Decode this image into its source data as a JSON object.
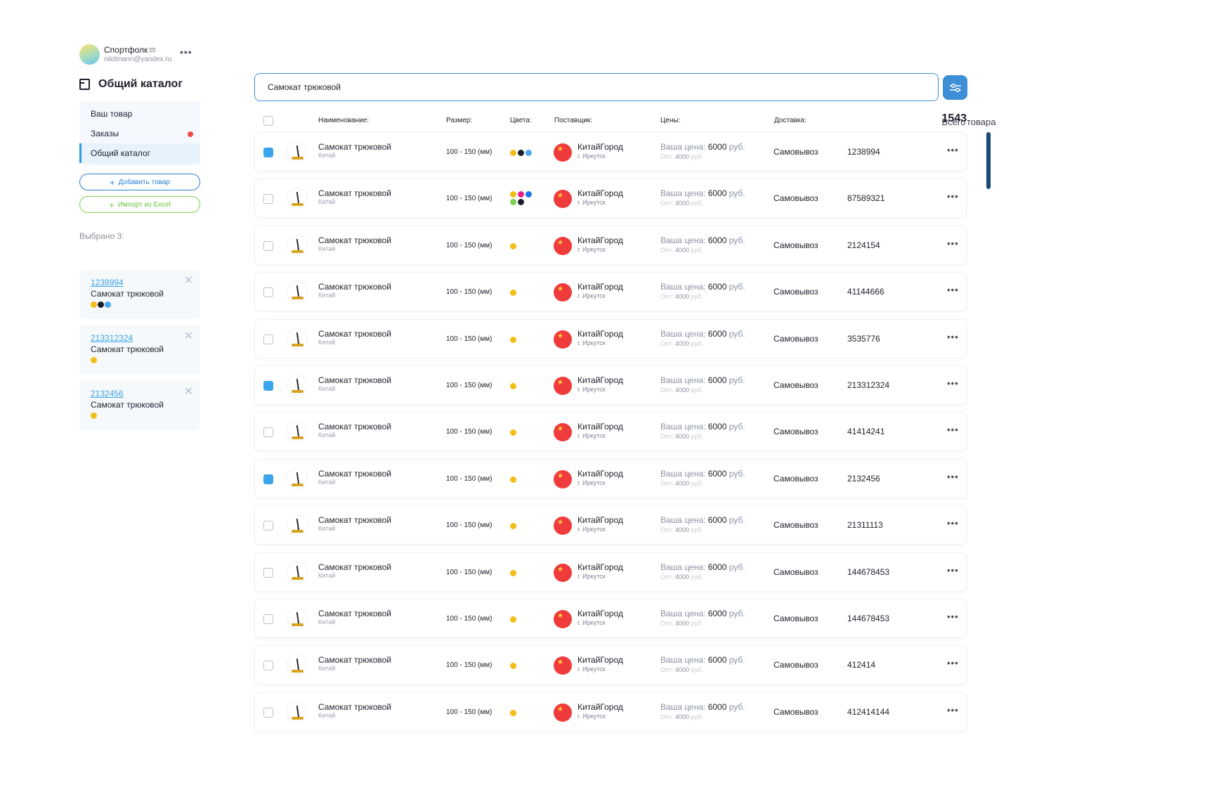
{
  "colors": {
    "accent": "#3c8ed6",
    "link": "#39a2e8",
    "green": "#6cc33c",
    "red": "#f2484a"
  },
  "user": {
    "name": "Спортфолк",
    "email": "nikitinann@yandex.ru",
    "more": "•••"
  },
  "sidebar": {
    "title": "Общий каталог",
    "menu": [
      {
        "label": "Ваш товар"
      },
      {
        "label": "Заказы",
        "badge": "red-dot"
      },
      {
        "label": "Общий каталог",
        "active": true
      }
    ],
    "add_button": "Добавить товар",
    "import_button": "Импорт из Excel",
    "selected_label": "Выбрано 3:",
    "selected": [
      {
        "id": "1238994",
        "name": "Самокат трюковой",
        "colors": [
          "#f2bd18",
          "#1b1f2a",
          "#4aa8f0"
        ]
      },
      {
        "id": "213312324",
        "name": "Самокат трюковой",
        "colors": [
          "#f2bd18"
        ]
      },
      {
        "id": "2132456",
        "name": "Самокат трюковой",
        "colors": [
          "#f2bd18"
        ]
      }
    ]
  },
  "search": {
    "value": "Самокат трюковой"
  },
  "table": {
    "columns": [
      "Наименование:",
      "Размер:",
      "Цвета:",
      "Поставщик:",
      "Цены:",
      "Доставка:"
    ],
    "total_prefix": "Всего",
    "total_count": "1543",
    "total_suffix": "товара",
    "rows": [
      {
        "checked": true,
        "name": "Самокат трюковой",
        "origin": "Китай",
        "size": "100 - 150 (мм)",
        "colors": [
          "#f2bd18",
          "#1b1f2a",
          "#4aa8f0"
        ],
        "supplier": "КитайГород",
        "city": "г. Иркутск",
        "price_label": "Ваша цена:",
        "price": "6000",
        "currency": "руб.",
        "opt_label": "Опт:",
        "opt": "4000",
        "opt_currency": "руб.",
        "delivery": "Самовывоз",
        "sku": "1238994"
      },
      {
        "checked": false,
        "name": "Самокат трюковой",
        "origin": "Китай",
        "size": "100 - 150 (мм)",
        "colors": [
          "#f2bd18",
          "#e8208c",
          "#1f73e8",
          "#7ccf4f",
          "#1b1f2a"
        ],
        "supplier": "КитайГород",
        "city": "г. Иркутск",
        "price_label": "Ваша цена:",
        "price": "6000",
        "currency": "руб.",
        "opt_label": "Опт:",
        "opt": "4000",
        "opt_currency": "руб.",
        "delivery": "Самовывоз",
        "sku": "87589321"
      },
      {
        "checked": false,
        "name": "Самокат трюковой",
        "origin": "Китай",
        "size": "100 - 150 (мм)",
        "colors": [
          "#f2bd18"
        ],
        "supplier": "КитайГород",
        "city": "г. Иркутск",
        "price_label": "Ваша цена:",
        "price": "6000",
        "currency": "руб.",
        "opt_label": "Опт:",
        "opt": "4000",
        "opt_currency": "руб.",
        "delivery": "Самовывоз",
        "sku": "2124154"
      },
      {
        "checked": false,
        "name": "Самокат трюковой",
        "origin": "Китай",
        "size": "100 - 150 (мм)",
        "colors": [
          "#f2bd18"
        ],
        "supplier": "КитайГород",
        "city": "г. Иркутск",
        "price_label": "Ваша цена:",
        "price": "6000",
        "currency": "руб.",
        "opt_label": "Опт:",
        "opt": "4000",
        "opt_currency": "руб.",
        "delivery": "Самовывоз",
        "sku": "41144666"
      },
      {
        "checked": false,
        "name": "Самокат трюковой",
        "origin": "Китай",
        "size": "100 - 150 (мм)",
        "colors": [
          "#f2bd18"
        ],
        "supplier": "КитайГород",
        "city": "г. Иркутск",
        "price_label": "Ваша цена:",
        "price": "6000",
        "currency": "руб.",
        "opt_label": "Опт:",
        "opt": "4000",
        "opt_currency": "руб.",
        "delivery": "Самовывоз",
        "sku": "3535776"
      },
      {
        "checked": true,
        "name": "Самокат трюковой",
        "origin": "Китай",
        "size": "100 - 150 (мм)",
        "colors": [
          "#f2bd18"
        ],
        "supplier": "КитайГород",
        "city": "г. Иркутск",
        "price_label": "Ваша цена:",
        "price": "6000",
        "currency": "руб.",
        "opt_label": "Опт:",
        "opt": "4000",
        "opt_currency": "руб.",
        "delivery": "Самовывоз",
        "sku": "213312324"
      },
      {
        "checked": false,
        "name": "Самокат трюковой",
        "origin": "Китай",
        "size": "100 - 150 (мм)",
        "colors": [
          "#f2bd18"
        ],
        "supplier": "КитайГород",
        "city": "г. Иркутск",
        "price_label": "Ваша цена:",
        "price": "6000",
        "currency": "руб.",
        "opt_label": "Опт:",
        "opt": "4000",
        "opt_currency": "руб.",
        "delivery": "Самовывоз",
        "sku": "41414241"
      },
      {
        "checked": true,
        "name": "Самокат трюковой",
        "origin": "Китай",
        "size": "100 - 150 (мм)",
        "colors": [
          "#f2bd18"
        ],
        "supplier": "КитайГород",
        "city": "г. Иркутск",
        "price_label": "Ваша цена:",
        "price": "6000",
        "currency": "руб.",
        "opt_label": "Опт:",
        "opt": "4000",
        "opt_currency": "руб.",
        "delivery": "Самовывоз",
        "sku": "2132456"
      },
      {
        "checked": false,
        "name": "Самокат трюковой",
        "origin": "Китай",
        "size": "100 - 150 (мм)",
        "colors": [
          "#f2bd18"
        ],
        "supplier": "КитайГород",
        "city": "г. Иркутск",
        "price_label": "Ваша цена:",
        "price": "6000",
        "currency": "руб.",
        "opt_label": "Опт:",
        "opt": "4000",
        "opt_currency": "руб.",
        "delivery": "Самовывоз",
        "sku": "21311113"
      },
      {
        "checked": false,
        "name": "Самокат трюковой",
        "origin": "Китай",
        "size": "100 - 150 (мм)",
        "colors": [
          "#f2bd18"
        ],
        "supplier": "КитайГород",
        "city": "г. Иркутск",
        "price_label": "Ваша цена:",
        "price": "6000",
        "currency": "руб.",
        "opt_label": "Опт:",
        "opt": "4000",
        "opt_currency": "руб.",
        "delivery": "Самовывоз",
        "sku": "144678453"
      },
      {
        "checked": false,
        "name": "Самокат трюковой",
        "origin": "Китай",
        "size": "100 - 150 (мм)",
        "colors": [
          "#f2bd18"
        ],
        "supplier": "КитайГород",
        "city": "г. Иркутск",
        "price_label": "Ваша цена:",
        "price": "6000",
        "currency": "руб.",
        "opt_label": "Опт:",
        "opt": "4000",
        "opt_currency": "руб.",
        "delivery": "Самовывоз",
        "sku": "144678453"
      },
      {
        "checked": false,
        "name": "Самокат трюковой",
        "origin": "Китай",
        "size": "100 - 150 (мм)",
        "colors": [
          "#f2bd18"
        ],
        "supplier": "КитайГород",
        "city": "г. Иркутск",
        "price_label": "Ваша цена:",
        "price": "6000",
        "currency": "руб.",
        "opt_label": "Опт:",
        "opt": "4000",
        "opt_currency": "руб.",
        "delivery": "Самовывоз",
        "sku": "412414"
      },
      {
        "checked": false,
        "name": "Самокат трюковой",
        "origin": "Китай",
        "size": "100 - 150 (мм)",
        "colors": [
          "#f2bd18"
        ],
        "supplier": "КитайГород",
        "city": "г. Иркутск",
        "price_label": "Ваша цена:",
        "price": "6000",
        "currency": "руб.",
        "opt_label": "Опт:",
        "opt": "4000",
        "opt_currency": "руб.",
        "delivery": "Самовывоз",
        "sku": "412414144"
      }
    ]
  }
}
